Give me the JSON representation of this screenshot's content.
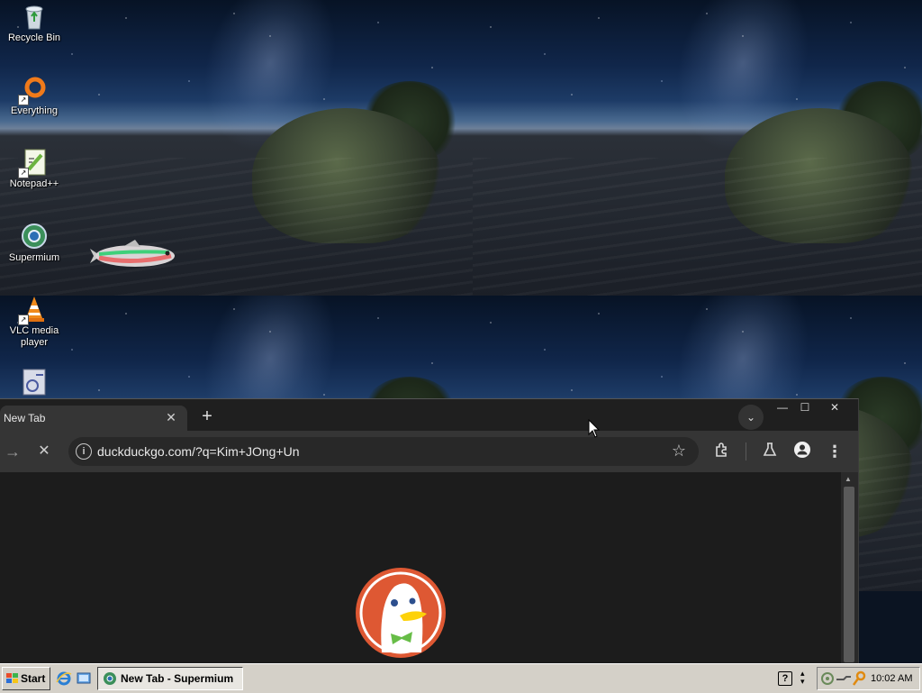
{
  "desktop": {
    "icons": [
      {
        "label": "Recycle Bin",
        "icon": "recycle-bin-icon"
      },
      {
        "label": "Everything",
        "icon": "everything-search-icon"
      },
      {
        "label": "Notepad++",
        "icon": "notepad-plus-plus-icon"
      },
      {
        "label": "Supermium",
        "icon": "supermium-browser-icon"
      },
      {
        "label": "VLC media player",
        "icon": "vlc-cone-icon"
      },
      {
        "label": "",
        "icon": "settings-tool-icon"
      }
    ]
  },
  "browser": {
    "tab_title": "New Tab",
    "tab_close": "✕",
    "new_tab": "+",
    "tab_list": "⌄",
    "window_controls": {
      "minimize": "—",
      "maximize": "☐",
      "close": "✕"
    },
    "nav": {
      "forward": "→",
      "stop": "✕"
    },
    "omnibox": {
      "url": "duckduckgo.com/?q=Kim+JOng+Un",
      "info": "i",
      "star": "☆"
    },
    "toolbar": {
      "extensions": "extensions-icon",
      "labs": "labs-flask-icon",
      "profile": "profile-icon",
      "menu": "⋮"
    },
    "page_logo": "duckduckgo-logo-icon"
  },
  "taskbar": {
    "start_label": "Start",
    "task_label": "New Tab - Supermium",
    "help": "?",
    "clock": "10:02 AM",
    "colors": {
      "face": "#d4d0c8"
    }
  }
}
